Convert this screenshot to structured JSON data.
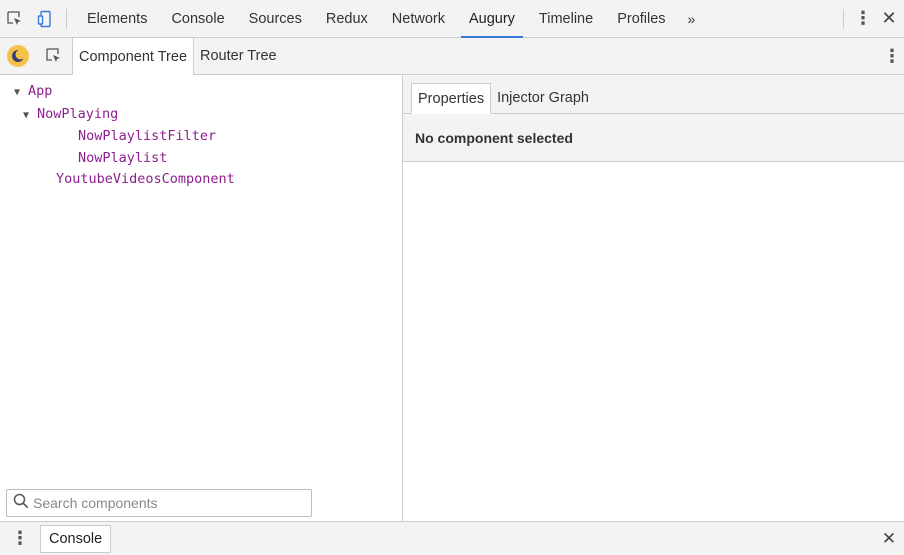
{
  "devtools": {
    "tabs": [
      "Elements",
      "Console",
      "Sources",
      "Redux",
      "Network",
      "Augury",
      "Timeline",
      "Profiles"
    ],
    "active_tab": "Augury",
    "more_label": "»",
    "menu_label": "⋮",
    "close_label": "✕"
  },
  "augury": {
    "subtabs": [
      "Component Tree",
      "Router Tree"
    ],
    "active_subtab": "Component Tree",
    "menu_label": "⋮",
    "logo_color": "#f5c146"
  },
  "tree": {
    "nodes": [
      {
        "label": "App",
        "expanded": true
      },
      {
        "label": "NowPlaying",
        "expanded": true
      },
      {
        "label": "NowPlaylistFilter"
      },
      {
        "label": "NowPlaylist"
      },
      {
        "label": "YoutubeVideosComponent"
      }
    ],
    "expand_glyph": "▼"
  },
  "search": {
    "placeholder": "Search components",
    "value": ""
  },
  "details": {
    "tabs": [
      "Properties",
      "Injector Graph"
    ],
    "active_tab": "Properties",
    "status": "No component selected"
  },
  "drawer": {
    "menu_label": "⋮",
    "tab": "Console",
    "close_label": "✕"
  },
  "colors": {
    "tree_text": "#8e1f8e",
    "active_tab_underline": "#3879d9",
    "toolbar_bg": "#f3f3f3",
    "border": "#cccccc"
  }
}
